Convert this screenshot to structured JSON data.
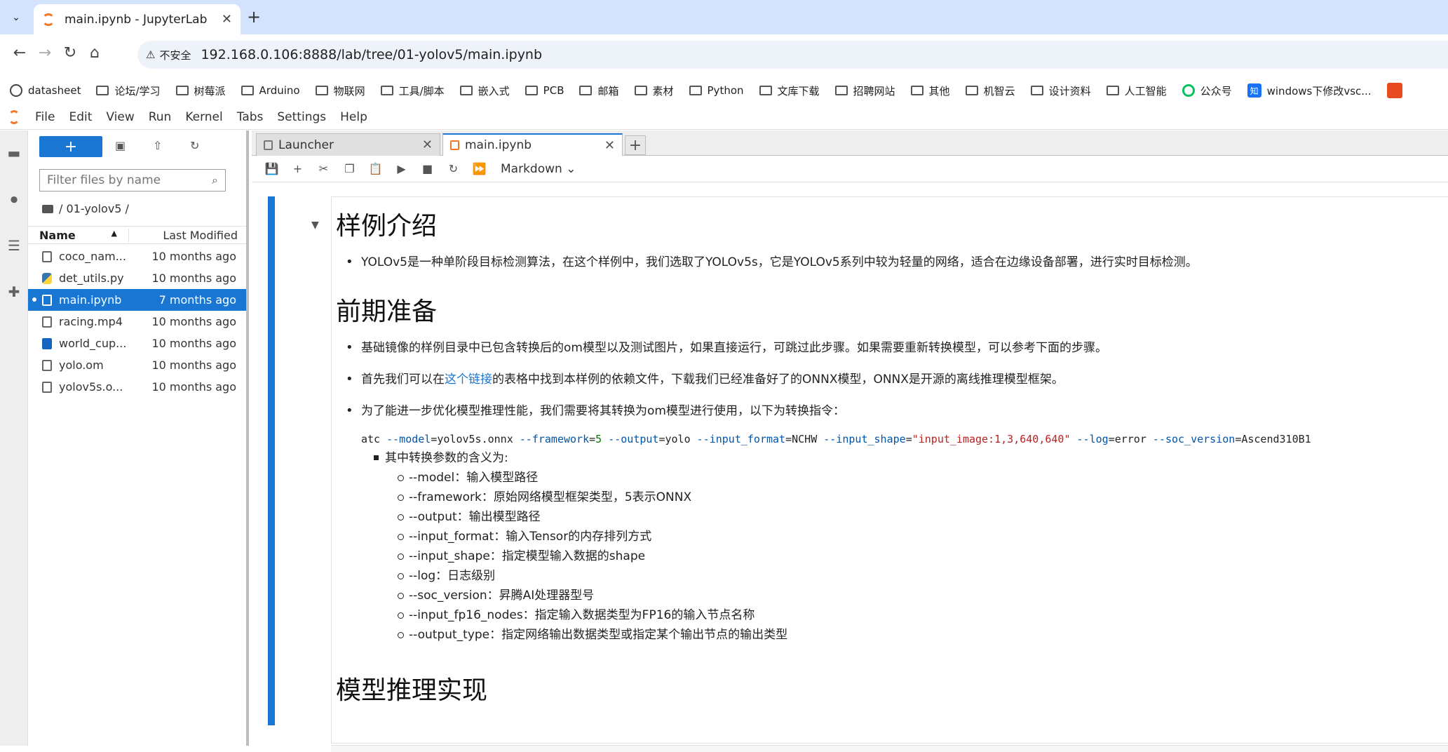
{
  "browser": {
    "tab_title": "main.ipynb - JupyterLab",
    "url": "192.168.0.106:8888/lab/tree/01-yolov5/main.ipynb",
    "security_label": "不安全"
  },
  "bookmarks": [
    {
      "label": "datasheet",
      "icon": "github-icon"
    },
    {
      "label": "论坛/学习",
      "icon": "folder-icon"
    },
    {
      "label": "树莓派",
      "icon": "folder-icon"
    },
    {
      "label": "Arduino",
      "icon": "folder-icon"
    },
    {
      "label": "物联网",
      "icon": "folder-icon"
    },
    {
      "label": "工具/脚本",
      "icon": "folder-icon"
    },
    {
      "label": "嵌入式",
      "icon": "folder-icon"
    },
    {
      "label": "PCB",
      "icon": "folder-icon"
    },
    {
      "label": "邮箱",
      "icon": "folder-icon"
    },
    {
      "label": "素材",
      "icon": "folder-icon"
    },
    {
      "label": "Python",
      "icon": "folder-icon"
    },
    {
      "label": "文库下载",
      "icon": "folder-icon"
    },
    {
      "label": "招聘网站",
      "icon": "folder-icon"
    },
    {
      "label": "其他",
      "icon": "folder-icon"
    },
    {
      "label": "机智云",
      "icon": "folder-icon"
    },
    {
      "label": "设计资料",
      "icon": "folder-icon"
    },
    {
      "label": "人工智能",
      "icon": "folder-icon"
    },
    {
      "label": "公众号",
      "icon": "wechat-icon"
    },
    {
      "label": "windows下修改vsc...",
      "icon": "zhihu-icon"
    }
  ],
  "jupyter_menu": [
    "File",
    "Edit",
    "View",
    "Run",
    "Kernel",
    "Tabs",
    "Settings",
    "Help"
  ],
  "filebrowser": {
    "filter_placeholder": "Filter files by name",
    "breadcrumb": "/ 01-yolov5 /",
    "col_name": "Name",
    "col_modified": "Last Modified",
    "files": [
      {
        "name": "coco_nam...",
        "modified": "10 months ago",
        "type": "file"
      },
      {
        "name": "det_utils.py",
        "modified": "10 months ago",
        "type": "py"
      },
      {
        "name": "main.ipynb",
        "modified": "7 months ago",
        "type": "nb"
      },
      {
        "name": "racing.mp4",
        "modified": "10 months ago",
        "type": "file"
      },
      {
        "name": "world_cup...",
        "modified": "10 months ago",
        "type": "img"
      },
      {
        "name": "yolo.om",
        "modified": "10 months ago",
        "type": "file"
      },
      {
        "name": "yolov5s.o...",
        "modified": "10 months ago",
        "type": "file"
      }
    ]
  },
  "doc_tabs": {
    "launcher": "Launcher",
    "notebook": "main.ipynb"
  },
  "toolbar": {
    "cell_type": "Markdown"
  },
  "notebook": {
    "h1_intro": "样例介绍",
    "intro_bullet": "YOLOv5是一种单阶段目标检测算法，在这个样例中，我们选取了YOLOv5s，它是YOLOv5系列中较为轻量的网络，适合在边缘设备部署，进行实时目标检测。",
    "h1_prep": "前期准备",
    "prep_bullet_1": "基础镜像的样例目录中已包含转换后的om模型以及测试图片，如果直接运行，可跳过此步骤。如果需要重新转换模型，可以参考下面的步骤。",
    "prep_bullet_2_pre": "首先我们可以在",
    "prep_bullet_2_link": "这个链接",
    "prep_bullet_2_post": "的表格中找到本样例的依赖文件，下载我们已经准备好了的ONNX模型，ONNX是开源的离线推理模型框架。",
    "prep_bullet_3": "为了能进一步优化模型推理性能，我们需要将其转换为om模型进行使用，以下为转换指令：",
    "code": {
      "p1": "atc ",
      "p2": "--model",
      "p3": "=yolov5s.onnx ",
      "p4": "--framework",
      "p5": "=",
      "p6": "5",
      "p7": " ",
      "p8": "--output",
      "p9": "=yolo ",
      "p10": "--input_format",
      "p11": "=NCHW ",
      "p12": "--input_shape",
      "p13": "=",
      "p14": "\"input_image:1,3,640,640\"",
      "p15": " ",
      "p16": "--log",
      "p17": "=error ",
      "p18": "--soc_version",
      "p19": "=Ascend310B1"
    },
    "params_title": "其中转换参数的含义为:",
    "params": [
      "--model：输入模型路径",
      "--framework：原始网络模型框架类型，5表示ONNX",
      "--output：输出模型路径",
      "--input_format：输入Tensor的内存排列方式",
      "--input_shape：指定模型输入数据的shape",
      "--log：日志级别",
      "--soc_version：昇腾AI处理器型号",
      "--input_fp16_nodes：指定输入数据类型为FP16的输入节点名称",
      "--output_type：指定网络输出数据类型或指定某个输出节点的输出类型"
    ],
    "h1_impl": "模型推理实现"
  }
}
